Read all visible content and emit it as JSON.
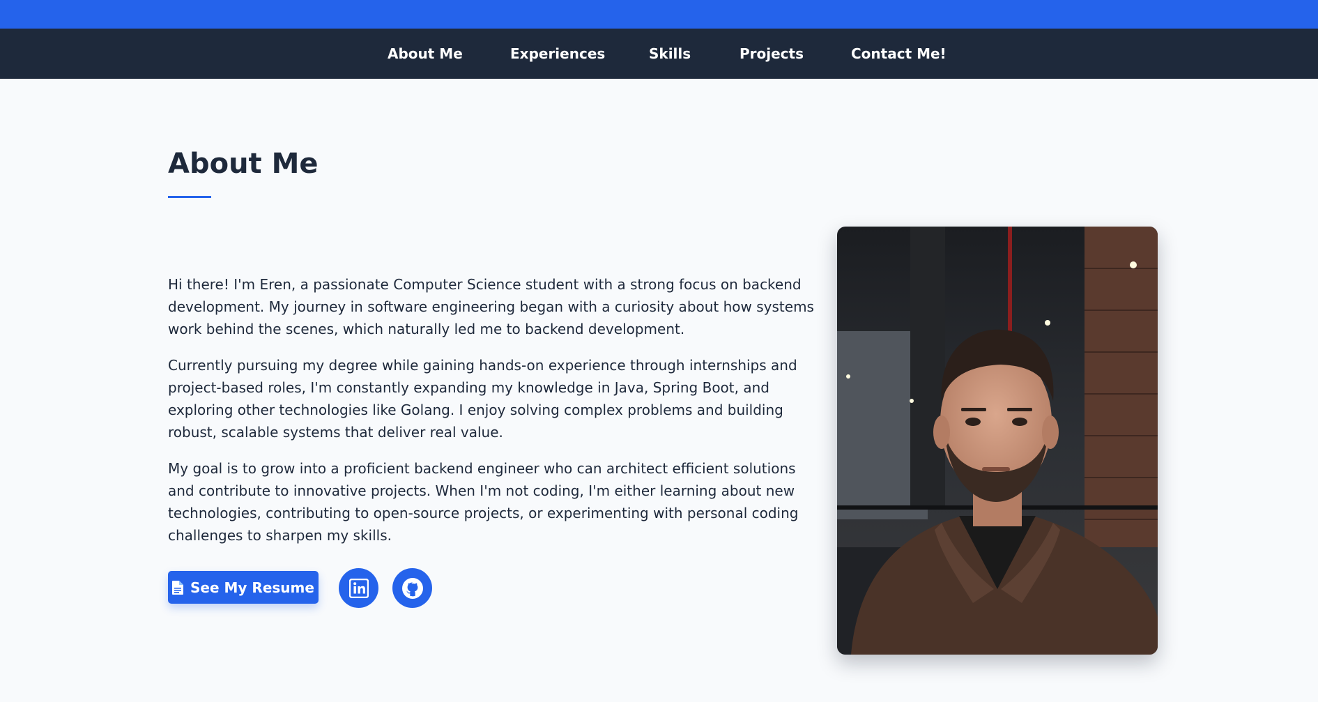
{
  "nav": {
    "items": [
      {
        "label": "About Me"
      },
      {
        "label": "Experiences"
      },
      {
        "label": "Skills"
      },
      {
        "label": "Projects"
      },
      {
        "label": "Contact Me!"
      }
    ]
  },
  "about": {
    "title": "About Me",
    "paragraphs": [
      "Hi there! I'm Eren, a passionate Computer Science student with a strong focus on backend development. My journey in software engineering began with a curiosity about how systems work behind the scenes, which naturally led me to backend development.",
      "Currently pursuing my degree while gaining hands-on experience through internships and project-based roles, I'm constantly expanding my knowledge in Java, Spring Boot, and exploring other technologies like Golang. I enjoy solving complex problems and building robust, scalable systems that deliver real value.",
      "My goal is to grow into a proficient backend engineer who can architect efficient solutions and contribute to innovative projects. When I'm not coding, I'm either learning about new technologies, contributing to open-source projects, or experimenting with personal coding challenges to sharpen my skills."
    ],
    "resume_label": "See My Resume",
    "resume_icon": "document-icon",
    "social": [
      {
        "name": "LinkedIn",
        "icon": "linkedin-icon"
      },
      {
        "name": "GitHub",
        "icon": "github-icon"
      }
    ],
    "photo_alt": "portrait photo"
  },
  "colors": {
    "accent": "#2563eb",
    "nav_bg": "#1e293b",
    "page_bg": "#f8fafc",
    "text": "#1e293b"
  }
}
